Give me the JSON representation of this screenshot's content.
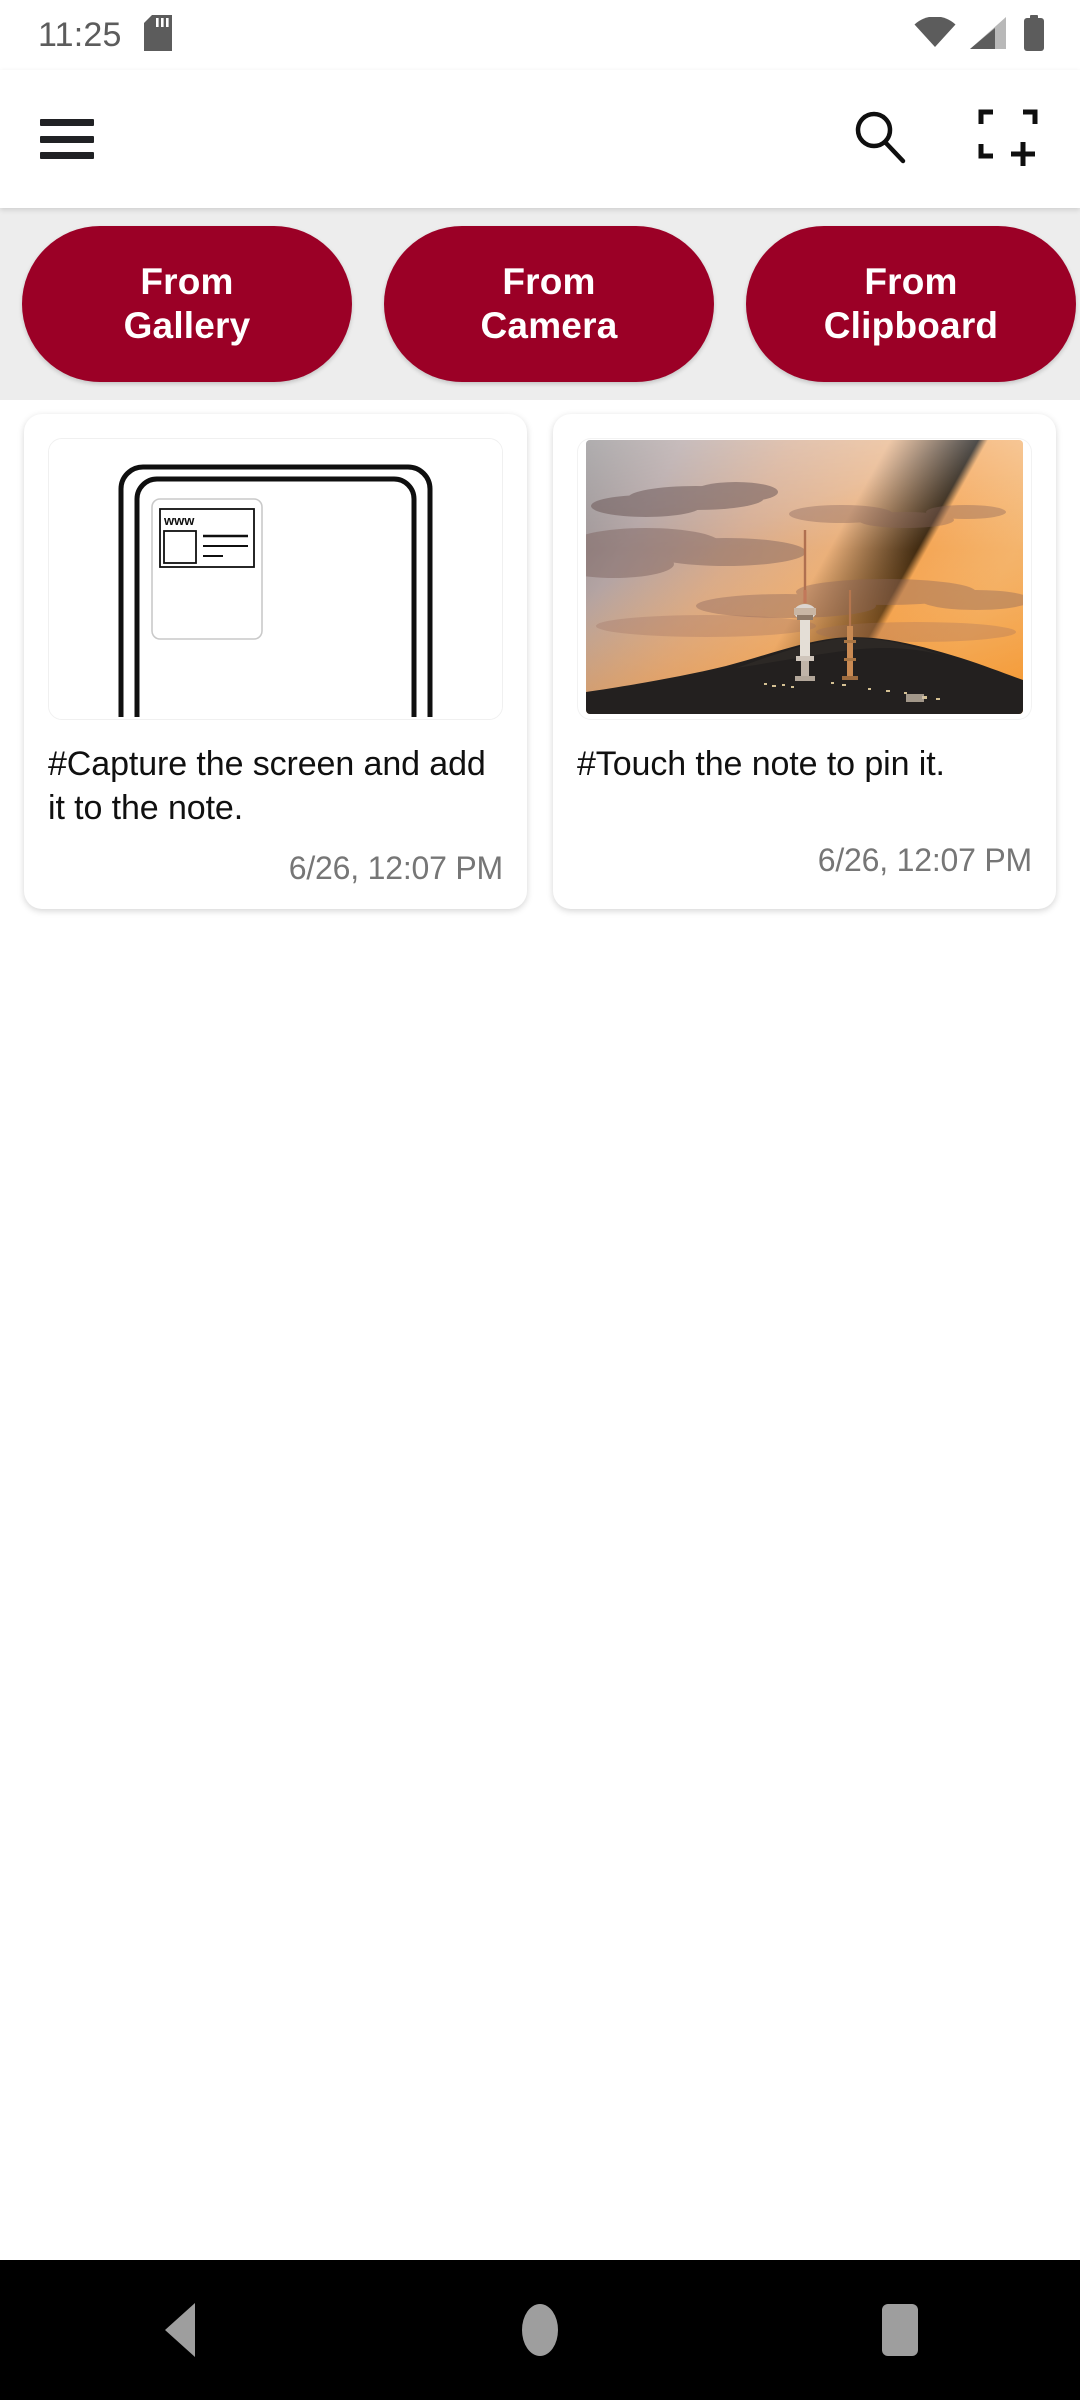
{
  "status_bar": {
    "time": "11:25",
    "icons": [
      "sd-card-icon",
      "wifi-icon",
      "cellular-signal-icon",
      "battery-icon"
    ]
  },
  "app_bar": {
    "menu_icon": "hamburger-menu-icon",
    "search_icon": "search-icon",
    "capture_icon": "screen-capture-add-icon"
  },
  "quick_actions": [
    {
      "label": "From\nGallery",
      "name": "from-gallery-button"
    },
    {
      "label": "From\nCamera",
      "name": "from-camera-button"
    },
    {
      "label": "From\nClipboard",
      "name": "from-clipboard-button"
    }
  ],
  "notes": [
    {
      "thumbnail": "screen-capture-illustration",
      "thumbnail_label": "www",
      "text": "#Capture the screen and add it to the note.",
      "time": "6/26, 12:07 PM"
    },
    {
      "thumbnail": "sunset-tower-photo",
      "text": "#Touch the note to pin it.",
      "time": "6/26, 12:07 PM"
    }
  ],
  "nav_bar": {
    "back": "back-button",
    "home": "home-button",
    "recents": "recents-button"
  },
  "colors": {
    "accent": "#9b0026",
    "strip_background": "#ededed",
    "text_primary": "#101010",
    "text_secondary": "#767676"
  }
}
